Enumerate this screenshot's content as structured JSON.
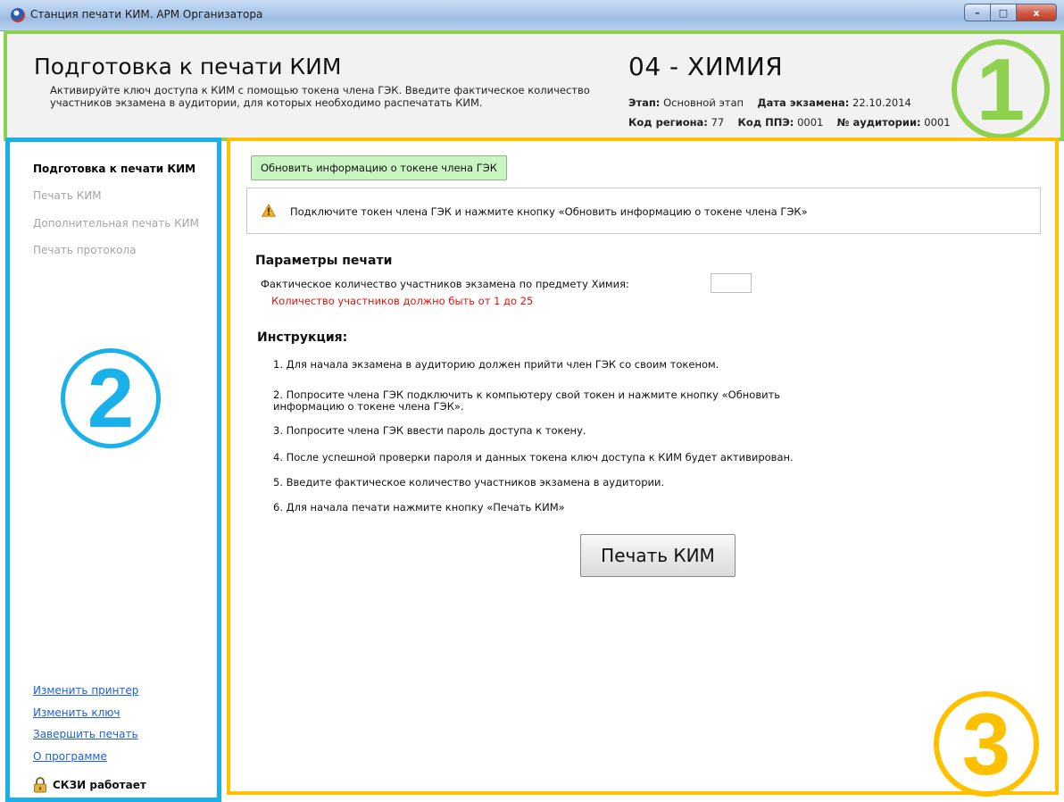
{
  "window": {
    "title": "Станция печати КИМ. АРМ Организатора",
    "buttons": {
      "minimize": "–",
      "maximize": "□",
      "close": "x"
    }
  },
  "header": {
    "title": "Подготовка к печати КИМ",
    "description": "Активируйте ключ доступа к КИМ с помощью токена члена ГЭК. Введите фактическое количество участников экзамена в аудитории, для которых необходимо распечатать КИМ.",
    "exam": "04 - ХИМИЯ",
    "stage_label": "Этап:",
    "stage_value": "Основной этап",
    "date_label": "Дата экзамена:",
    "date_value": "22.10.2014",
    "region_label": "Код региона:",
    "region_value": "77",
    "ppe_label": "Код ППЭ:",
    "ppe_value": "0001",
    "room_label": "№ аудитории:",
    "room_value": "0001"
  },
  "annotations": {
    "one": "1",
    "two": "2",
    "three": "3"
  },
  "sidebar": {
    "items": [
      {
        "label": "Подготовка к печати КИМ"
      },
      {
        "label": "Печать КИМ"
      },
      {
        "label": "Дополнительная печать КИМ"
      },
      {
        "label": "Печать протокола"
      }
    ],
    "links": [
      {
        "label": "Изменить принтер"
      },
      {
        "label": "Изменить ключ"
      },
      {
        "label": "Завершить печать"
      },
      {
        "label": "О программе"
      }
    ],
    "status": "СКЗИ работает"
  },
  "main": {
    "refresh_button": "Обновить информацию о токене члена ГЭК",
    "warning": "Подключите токен члена ГЭК и нажмите кнопку «Обновить информацию о токене члена ГЭК»",
    "params_title": "Параметры печати",
    "participants_label": "Фактическое количество участников экзамена по предмету Химия:",
    "participants_value": "",
    "participants_error": "Количество участников должно быть от 1 до 25",
    "instructions_title": "Инструкция:",
    "instructions": [
      "1. Для начала экзамена в аудиторию должен прийти член ГЭК со своим токеном.",
      "2. Попросите члена ГЭК подключить к компьютеру свой токен и нажмите кнопку «Обновить информацию о токене члена ГЭК».",
      "3. Попросите члена ГЭК ввести пароль доступа к токену.",
      "4. После успешной проверки пароля и данных токена ключ доступа к КИМ будет активирован.",
      "5. Введите фактическое количество участников экзамена в аудитории.",
      "6. Для начала печати нажмите кнопку «Печать КИМ»"
    ],
    "print_button": "Печать КИМ"
  },
  "colors": {
    "header_frame": "#8ed14f",
    "sidebar_frame": "#1ab0ea",
    "main_frame": "#ffc000",
    "link": "#1f5fd6",
    "error": "#e0120c",
    "refresh_button_bg": "#c9f5c2"
  },
  "icons": {
    "app": "app-logo-icon",
    "warning": "warning-triangle-icon",
    "status": "lock-icon"
  }
}
